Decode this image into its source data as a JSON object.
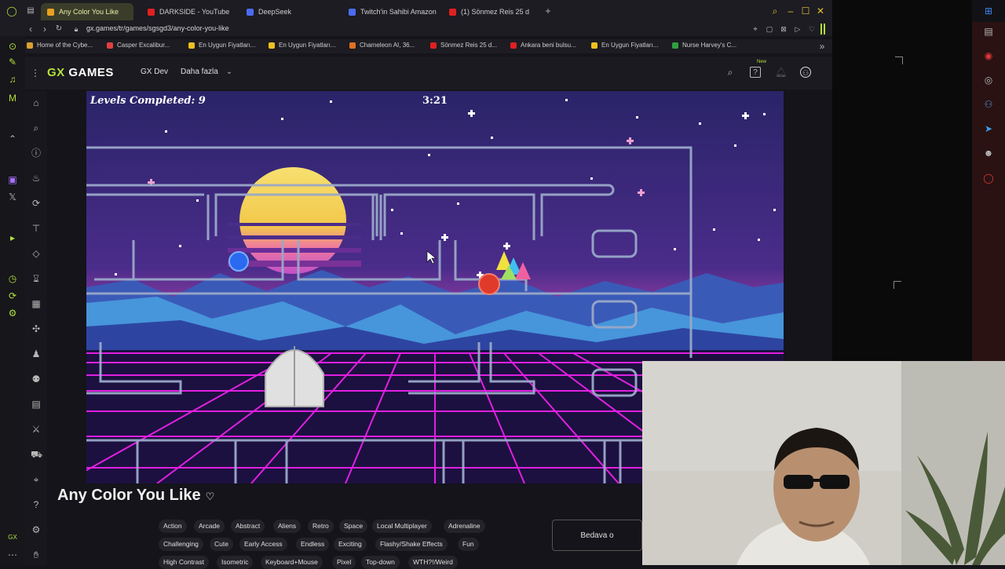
{
  "tabs": [
    {
      "label": "Any Color You Like",
      "color": "#e8a020",
      "active": true
    },
    {
      "label": "DARKSIDE - YouTube",
      "color": "#e02020",
      "active": false
    },
    {
      "label": "DeepSeek",
      "color": "#4a6cf0",
      "active": false
    },
    {
      "label": "Twitch'in Sahibi Amazon",
      "color": "#4a6cf0",
      "active": false
    },
    {
      "label": "(1) Sönmez Reis 25 d",
      "color": "#e02020",
      "active": false
    }
  ],
  "address": {
    "url": "gx.games/tr/games/sgsgd3/any-color-you-like"
  },
  "bookmarks": [
    {
      "label": "Home of the Cybe...",
      "color": "#d8a030"
    },
    {
      "label": "Casper Excalibur...",
      "color": "#e04040"
    },
    {
      "label": "En Uygun Fiyatları...",
      "color": "#f0c020"
    },
    {
      "label": "En Uygun Fiyatları...",
      "color": "#f0c020"
    },
    {
      "label": "Chameleon AI, 36...",
      "color": "#e07020"
    },
    {
      "label": "Sönmez Reis 25 d...",
      "color": "#e02020"
    },
    {
      "label": "Ankara beni bulsu...",
      "color": "#e02020"
    },
    {
      "label": "En Uygun Fiyatları...",
      "color": "#f0c020"
    },
    {
      "label": "Nurse Harvey's C...",
      "color": "#30a040"
    }
  ],
  "header": {
    "logo_gx": "GX",
    "logo_games": "GAMES",
    "dev_link": "GX Dev",
    "more_link": "Daha fazla",
    "new_badge": "New"
  },
  "game": {
    "levels_label": "Levels Completed: 9",
    "timer": "3:21"
  },
  "game_title": "Any Color You Like",
  "tags_row1": [
    "Action",
    "Arcade",
    "Abstract",
    "Aliens",
    "Retro",
    "Space",
    "Local Multiplayer",
    "Adrenaline"
  ],
  "tags_row2": [
    "Challenging",
    "Cute",
    "Early Access",
    "Endless",
    "Exciting",
    "Flashy/Shake Effects",
    "Fun"
  ],
  "tags_row3": [
    "High Contrast",
    "Isometric",
    "Keyboard+Mouse",
    "Pixel",
    "Top-down",
    "WTH?!/Weird"
  ],
  "play_button": "Bedava o",
  "accent": "#b4e03a"
}
